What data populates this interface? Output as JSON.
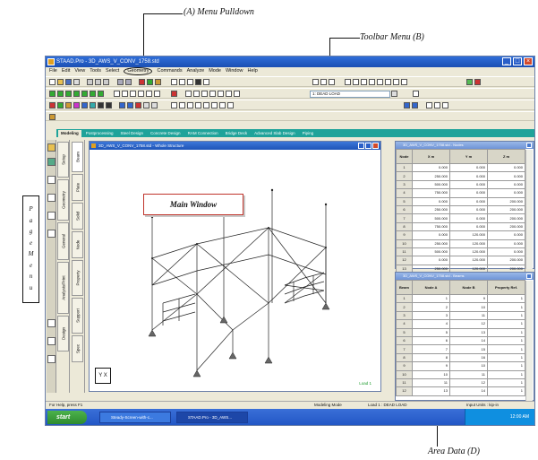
{
  "annotations": {
    "menu_pulldown": "(A) Menu Pulldown",
    "toolbar_menu": "Toolbar Menu (B)",
    "page_menu_letters": [
      "P",
      "a",
      "g",
      "e",
      "M",
      "e",
      "n",
      "u"
    ],
    "area_data": "Area Data (D)"
  },
  "app": {
    "title": "STAAD.Pro - 3D_AWS_V_CONV_1758.std",
    "menus": [
      "File",
      "Edit",
      "View",
      "Tools",
      "Select",
      "Geometry",
      "Commands",
      "Analyze",
      "Mode",
      "Window",
      "Help"
    ],
    "combo_value": "1: DEAD LOAD"
  },
  "page_tabs": [
    "Modeling",
    "Postprocessing",
    "Steel Design",
    "Concrete Design",
    "RAM Connection",
    "Bridge Deck",
    "Advanced Slab Design",
    "Piping"
  ],
  "left_tabs_outer": [
    "Setup",
    "Geometry",
    "General",
    "Analysis/Print",
    "Design"
  ],
  "left_tabs_inner": [
    "Beam",
    "Plate",
    "Solid",
    "Node",
    "Property",
    "Support",
    "Spec"
  ],
  "main_window": {
    "title": "3D_AWS_V_CONV_1758.std - Whole Structure",
    "callout": "Main Window",
    "status_text": "Load 1",
    "axis_label": "Y X"
  },
  "nodes_table": {
    "title": "3D_AWS_V_CONV_1758.std - Nodes",
    "columns": [
      "Node",
      "X m",
      "Y m",
      "Z m"
    ],
    "rows": [
      [
        "1",
        "0.000",
        "0.000",
        "0.000"
      ],
      [
        "2",
        "250.000",
        "0.000",
        "0.000"
      ],
      [
        "3",
        "500.000",
        "0.000",
        "0.000"
      ],
      [
        "4",
        "750.000",
        "0.000",
        "0.000"
      ],
      [
        "5",
        "0.000",
        "0.000",
        "200.000"
      ],
      [
        "6",
        "250.000",
        "0.000",
        "200.000"
      ],
      [
        "7",
        "500.000",
        "0.000",
        "200.000"
      ],
      [
        "8",
        "750.000",
        "0.000",
        "200.000"
      ],
      [
        "9",
        "0.000",
        "120.000",
        "0.000"
      ],
      [
        "10",
        "250.000",
        "120.000",
        "0.000"
      ],
      [
        "11",
        "500.000",
        "120.000",
        "0.000"
      ],
      [
        "12",
        "0.000",
        "120.000",
        "200.000"
      ],
      [
        "13",
        "250.000",
        "120.000",
        "200.000"
      ],
      [
        "14",
        "500.000",
        "120.000",
        "200.000"
      ]
    ]
  },
  "beams_table": {
    "title": "3D_AWS_V_CONV_1758.std - Beams",
    "columns": [
      "Beam",
      "Node A",
      "Node B",
      "Property Ref."
    ],
    "rows": [
      [
        "1",
        "1",
        "9",
        "1"
      ],
      [
        "2",
        "2",
        "10",
        "1"
      ],
      [
        "3",
        "3",
        "11",
        "1"
      ],
      [
        "4",
        "4",
        "12",
        "1"
      ],
      [
        "5",
        "5",
        "13",
        "1"
      ],
      [
        "6",
        "6",
        "14",
        "1"
      ],
      [
        "7",
        "7",
        "15",
        "1"
      ],
      [
        "8",
        "8",
        "16",
        "1"
      ],
      [
        "9",
        "9",
        "10",
        "1"
      ],
      [
        "10",
        "10",
        "11",
        "1"
      ],
      [
        "11",
        "11",
        "12",
        "1"
      ],
      [
        "12",
        "13",
        "14",
        "1"
      ]
    ]
  },
  "status_bar": {
    "help": "For Help, press F1",
    "mode": "Modeling Mode",
    "load": "Load 1 : DEAD LOAD",
    "units": "Input Units : kip-in"
  },
  "taskbar": {
    "start": "start",
    "tasks": [
      "Steady-Screen-with-c...",
      "STAAD.Pro - 3D_AWS..."
    ],
    "clock": "12:00 AM"
  },
  "colors": {
    "tab_strip": "#1fa39a",
    "titlebar": "#1b4fb3",
    "callout_border": "#c0342b"
  }
}
